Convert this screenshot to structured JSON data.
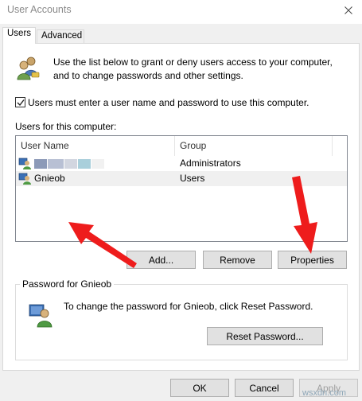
{
  "window": {
    "title": "User Accounts",
    "close_glyph": "✕"
  },
  "tabs": [
    {
      "label": "Users",
      "active": true
    },
    {
      "label": "Advanced",
      "active": false
    }
  ],
  "intro": {
    "line1": "Use the list below to grant or deny users access to your computer,",
    "line2": "and to change passwords and other settings."
  },
  "must_login": {
    "label": "Users must enter a user name and password to use this computer.",
    "checked": true
  },
  "users_list": {
    "label": "Users for this computer:",
    "columns": [
      "User Name",
      "Group"
    ],
    "rows": [
      {
        "name": "",
        "group": "Administrators",
        "name_redacted": true
      },
      {
        "name": "Gnieob",
        "group": "Users",
        "selected": true
      }
    ]
  },
  "buttons": {
    "add": "Add...",
    "remove": "Remove",
    "properties": "Properties"
  },
  "password_group": {
    "title": "Password for Gnieob",
    "text": "To change the password for Gnieob, click Reset Password.",
    "reset": "Reset Password..."
  },
  "footer": {
    "ok": "OK",
    "cancel": "Cancel",
    "apply": "Apply"
  },
  "watermark": "wsxdn.com",
  "colors": {
    "annotation_arrow": "#ee1c1c",
    "selection": "#f0f0f0",
    "dialog_bg": "#f0f0f0"
  },
  "icons": {
    "users": "users-icon",
    "user_row": "user-row-icon",
    "password": "user-key-icon"
  }
}
